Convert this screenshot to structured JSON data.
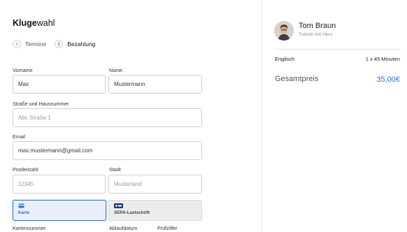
{
  "brand": {
    "bold": "Kluge",
    "light": "wahl"
  },
  "steps": [
    {
      "num": "1",
      "label": "Termine"
    },
    {
      "num": "2",
      "label": "Bezahlung"
    }
  ],
  "form": {
    "vorname": {
      "label": "Vorname",
      "value": "Max"
    },
    "name": {
      "label": "Name",
      "value": "Mustermann"
    },
    "street": {
      "label": "Straße und Hausnummer",
      "placeholder": "Abc Straße 1"
    },
    "email": {
      "label": "Email",
      "value": "max.mustermann@gmail.com"
    },
    "plz": {
      "label": "Postleitzahl",
      "placeholder": "12345"
    },
    "city": {
      "label": "Stadt",
      "placeholder": "Musterland"
    },
    "card_number_label": "Kartennummer",
    "expiry_label": "Ablaufdatum",
    "cvc_label": "Prüfziffer"
  },
  "payment_methods": [
    {
      "label": "Karte",
      "icon": "credit-card-icon",
      "selected": true
    },
    {
      "label": "SEPA-Lastschrift",
      "icon": "sepa-icon",
      "selected": false
    }
  ],
  "summary": {
    "tutor_name": "Tom Braun",
    "tutor_subtitle": "TutorIn mit Herz",
    "course_language": "Englisch",
    "course_duration": "1 x 45 Minuten",
    "total_label": "Gesamtpreis",
    "total_value": "35,00€"
  },
  "colors": {
    "accent": "#2d6fd8",
    "border": "#cfcfcf",
    "sepa_bg": "#ececec"
  }
}
